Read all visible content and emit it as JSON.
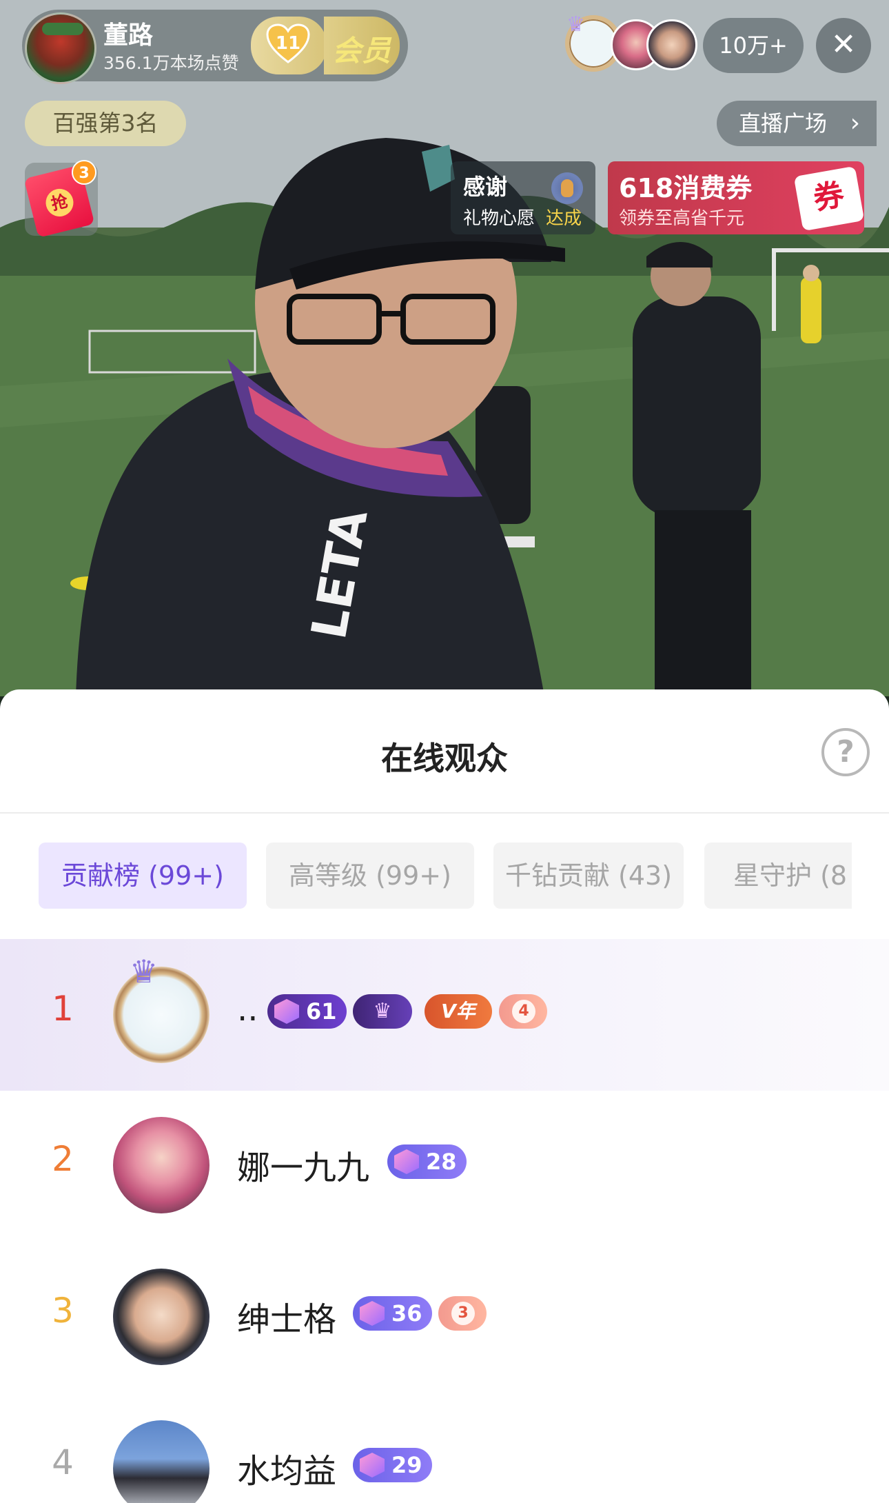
{
  "host": {
    "name": "董路",
    "likes": "356.1万本场点赞",
    "fan_level": "11",
    "member_label": "会员"
  },
  "viewers": {
    "count_label": "10万+"
  },
  "rank_label": "百强第3名",
  "plaza_label": "直播广场",
  "redpack": {
    "glyph": "抢",
    "count": "3"
  },
  "thanks_card": {
    "title": "感谢",
    "subtitle": "礼物心愿",
    "status": "达成"
  },
  "coupon_card": {
    "title": "618消费券",
    "subtitle": "领券至高省千元",
    "tag": "券"
  },
  "panel": {
    "title": "在线观众",
    "help": "?"
  },
  "tabs": [
    {
      "label": "贡献榜 (99+)"
    },
    {
      "label": "高等级 (99+)"
    },
    {
      "label": "千钻贡献 (43)"
    },
    {
      "label": "星守护 (8"
    }
  ],
  "audience": [
    {
      "rank": "1",
      "name": "..",
      "level": "61",
      "v_badge": "V年",
      "heart_level": "4"
    },
    {
      "rank": "2",
      "name": "娜一九九",
      "level": "28"
    },
    {
      "rank": "3",
      "name": "绅士格",
      "level": "36",
      "heart_level": "3"
    },
    {
      "rank": "4",
      "name": "水均益",
      "level": "29"
    }
  ],
  "colors": {
    "accent_purple": "#6b48d8",
    "rank1": "#e0413a",
    "rank2": "#ef7d36",
    "rank3": "#f0b33b",
    "rank_other": "#a9a9a9"
  }
}
